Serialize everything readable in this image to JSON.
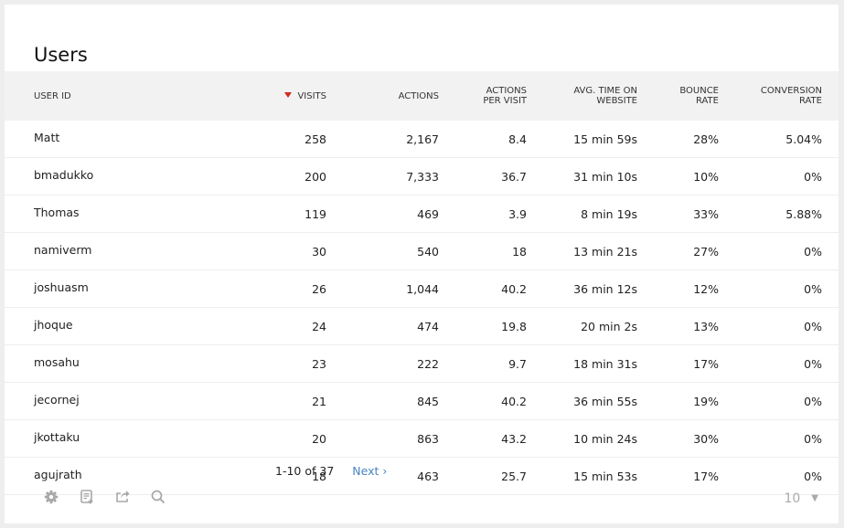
{
  "title": "Users",
  "columns": [
    {
      "label": "USER ID",
      "label2": ""
    },
    {
      "label": "VISITS",
      "label2": "",
      "sorted": "desc"
    },
    {
      "label": "ACTIONS",
      "label2": ""
    },
    {
      "label": "ACTIONS",
      "label2": "PER VISIT"
    },
    {
      "label": "AVG. TIME ON",
      "label2": "WEBSITE"
    },
    {
      "label": "BOUNCE",
      "label2": "RATE"
    },
    {
      "label": "CONVERSION",
      "label2": "RATE"
    }
  ],
  "rows": [
    [
      "Matt",
      "258",
      "2,167",
      "8.4",
      "15 min 59s",
      "28%",
      "5.04%"
    ],
    [
      "bmadukko",
      "200",
      "7,333",
      "36.7",
      "31 min 10s",
      "10%",
      "0%"
    ],
    [
      "Thomas",
      "119",
      "469",
      "3.9",
      "8 min 19s",
      "33%",
      "5.88%"
    ],
    [
      "namiverm",
      "30",
      "540",
      "18",
      "13 min 21s",
      "27%",
      "0%"
    ],
    [
      "joshuasm",
      "26",
      "1,044",
      "40.2",
      "36 min 12s",
      "12%",
      "0%"
    ],
    [
      "jhoque",
      "24",
      "474",
      "19.8",
      "20 min 2s",
      "13%",
      "0%"
    ],
    [
      "mosahu",
      "23",
      "222",
      "9.7",
      "18 min 31s",
      "17%",
      "0%"
    ],
    [
      "jecornej",
      "21",
      "845",
      "40.2",
      "36 min 55s",
      "19%",
      "0%"
    ],
    [
      "jkottaku",
      "20",
      "863",
      "43.2",
      "10 min 24s",
      "30%",
      "0%"
    ],
    [
      "agujrath",
      "18",
      "463",
      "25.7",
      "15 min 53s",
      "17%",
      "0%"
    ]
  ],
  "pagination": {
    "range": "1-10 of 37",
    "next": "Next ›"
  },
  "footer": {
    "icons": [
      "gear-icon",
      "export-report-icon",
      "share-icon",
      "search-icon"
    ],
    "limit": "10",
    "limit_caret": "▼"
  },
  "colors": {
    "sort_arrow": "#d4291f",
    "link": "#4a84c1",
    "header_bg": "#f2f2f2"
  }
}
